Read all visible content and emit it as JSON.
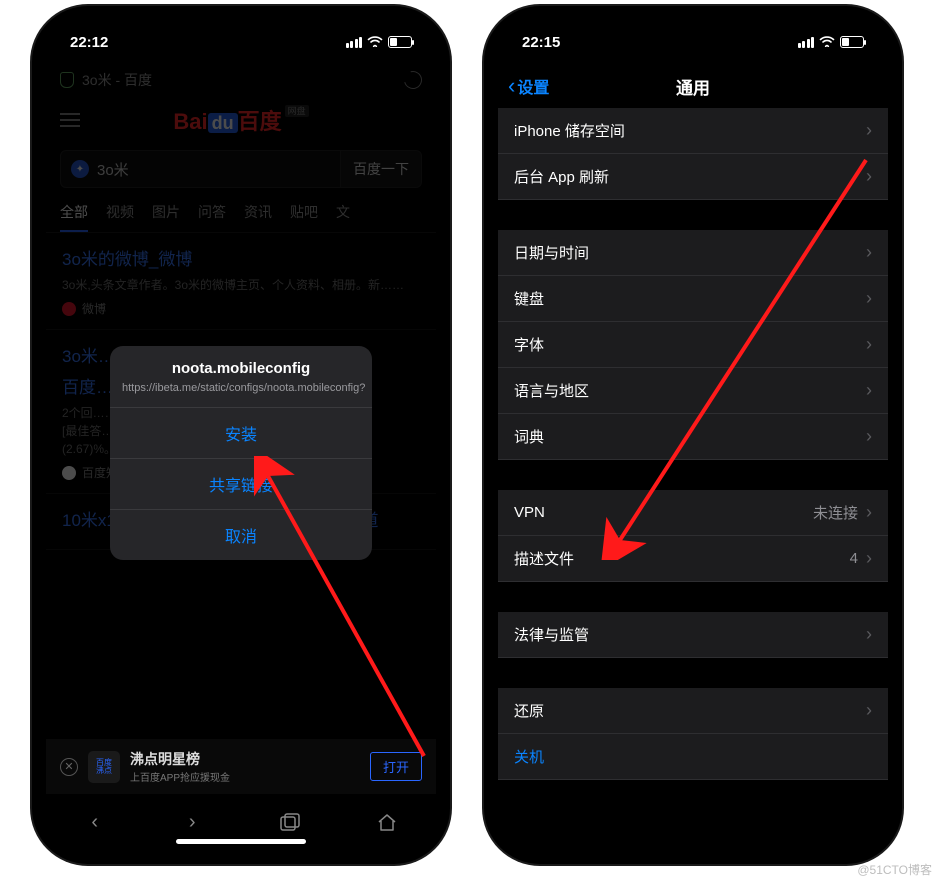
{
  "watermark": "@51CTO博客",
  "left": {
    "time": "22:12",
    "url_bar": "3o米 - 百度",
    "search_value": "3o米",
    "search_button": "百度一下",
    "tabs": [
      "全部",
      "视频",
      "图片",
      "问答",
      "资讯",
      "贴吧",
      "文"
    ],
    "result1_title": "3o米的微博_微博",
    "result1_meta": "3o米,头条文章作者。3o米的微博主页、个人资料、相册。新……",
    "result1_source": "微博",
    "result2_title_a": "3o米……",
    "result2_title_b": "百度……",
    "result2_meta1": "2个回……",
    "result2_meta2": "[最佳答……",
    "result2_meta3": "(2.67)%。",
    "result2_source": "百度知道",
    "result3_title": "10米x10米Xo、3o米是多少立方_百度知道",
    "banner": {
      "logo_top": "百度",
      "logo_bottom": "沸点",
      "title": "沸点明星榜",
      "subtitle": "上百度APP抢应援现金",
      "open": "打开"
    },
    "sheet": {
      "title": "noota.mobileconfig",
      "url": "https://ibeta.me/static/configs/noota.mobileconfig?",
      "install": "安装",
      "share": "共享链接",
      "cancel": "取消"
    }
  },
  "right": {
    "time": "22:15",
    "back_label": "设置",
    "title": "通用",
    "rows": [
      {
        "label": "iPhone 储存空间",
        "detail": ""
      },
      {
        "label": "后台 App 刷新",
        "detail": ""
      }
    ],
    "rows2": [
      {
        "label": "日期与时间",
        "detail": ""
      },
      {
        "label": "键盘",
        "detail": ""
      },
      {
        "label": "字体",
        "detail": ""
      },
      {
        "label": "语言与地区",
        "detail": ""
      },
      {
        "label": "词典",
        "detail": ""
      }
    ],
    "rows3": [
      {
        "label": "VPN",
        "detail": "未连接"
      },
      {
        "label": "描述文件",
        "detail": "4"
      }
    ],
    "rows4": [
      {
        "label": "法律与监管",
        "detail": ""
      }
    ],
    "rows5": [
      {
        "label": "还原",
        "detail": ""
      }
    ],
    "shutdown": "关机"
  }
}
